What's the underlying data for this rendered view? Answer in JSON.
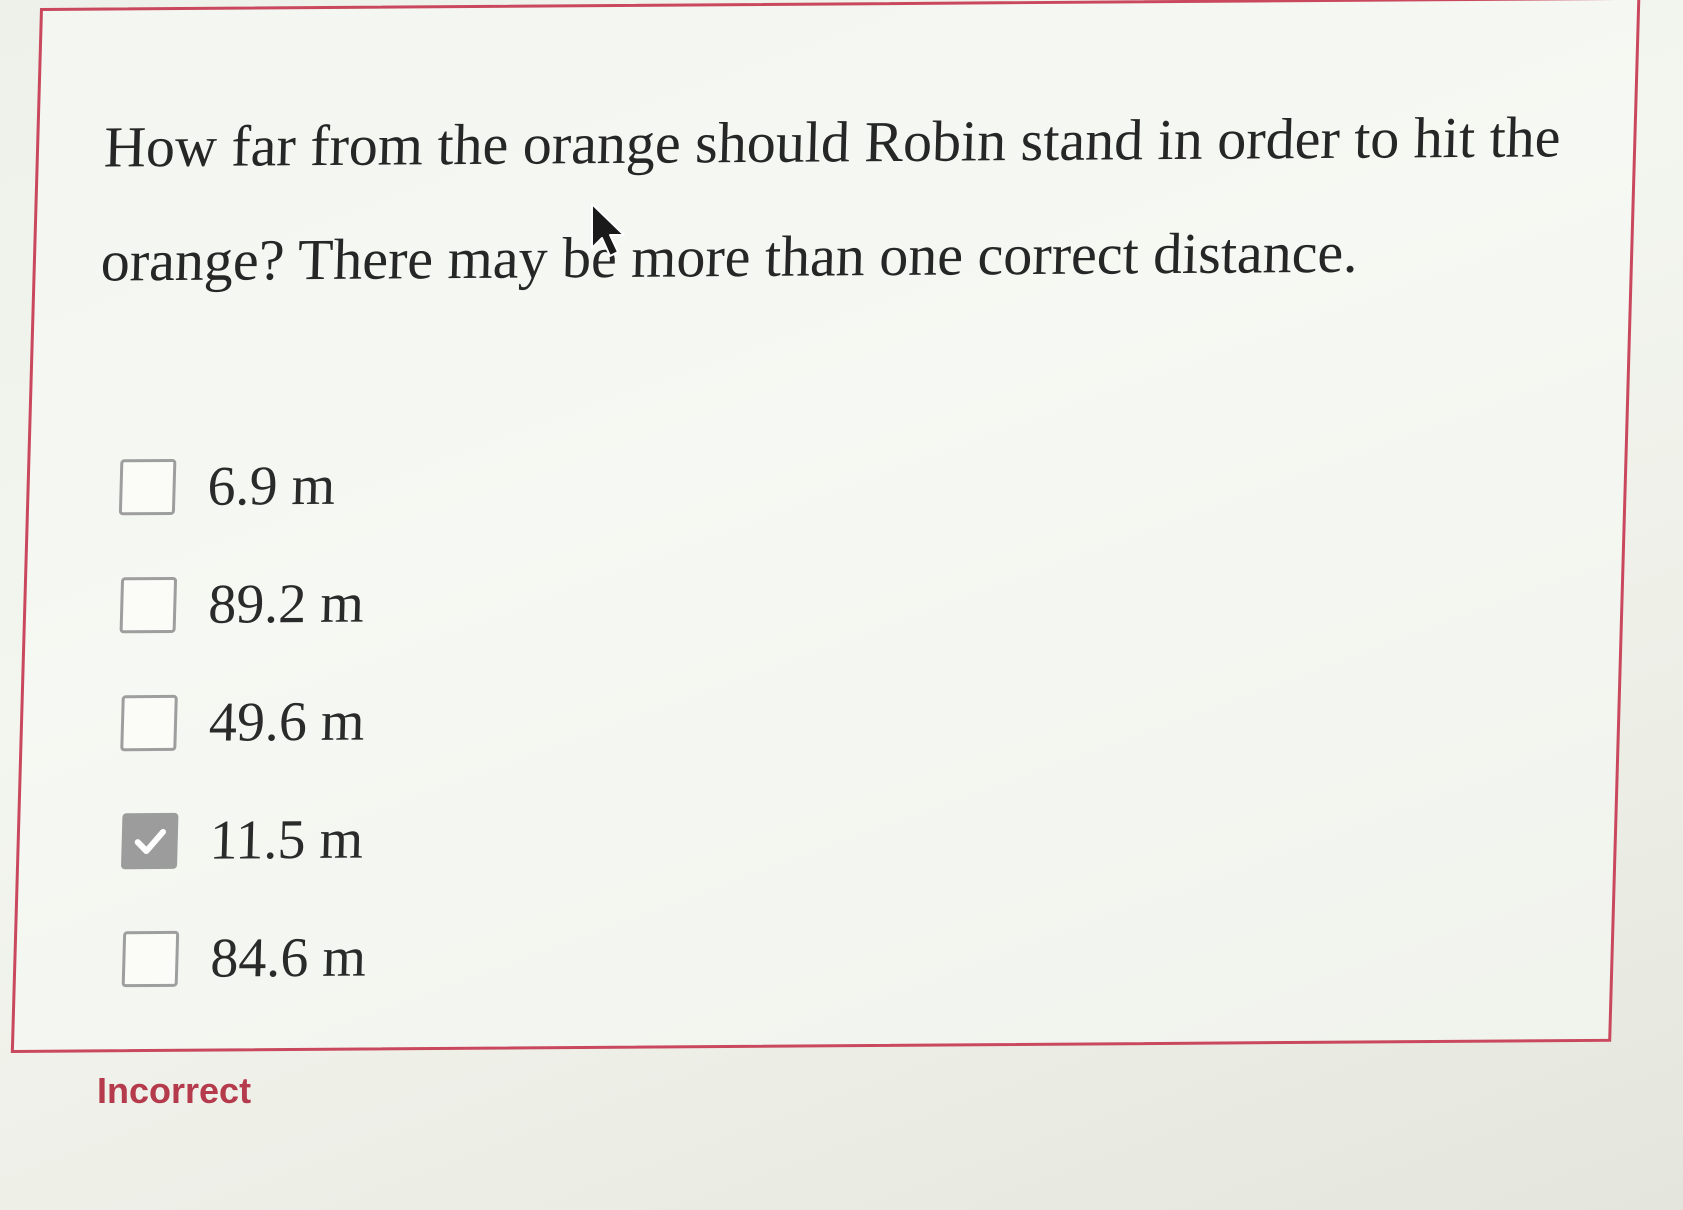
{
  "question": {
    "text": "How far from the orange should Robin stand in order to hit the orange? There may be more than one correct distance."
  },
  "options": [
    {
      "label": "6.9 m",
      "checked": false
    },
    {
      "label": "89.2 m",
      "checked": false
    },
    {
      "label": "49.6 m",
      "checked": false
    },
    {
      "label": "11.5 m",
      "checked": true
    },
    {
      "label": "84.6 m",
      "checked": false
    }
  ],
  "feedback": {
    "text": "Incorrect"
  },
  "colors": {
    "border": "#c9485d",
    "feedback": "#b43a4c",
    "checked_box": "#9c9c9c"
  },
  "icons": {
    "checked_box": "checkmark-icon",
    "pointer": "mouse-cursor-icon"
  }
}
